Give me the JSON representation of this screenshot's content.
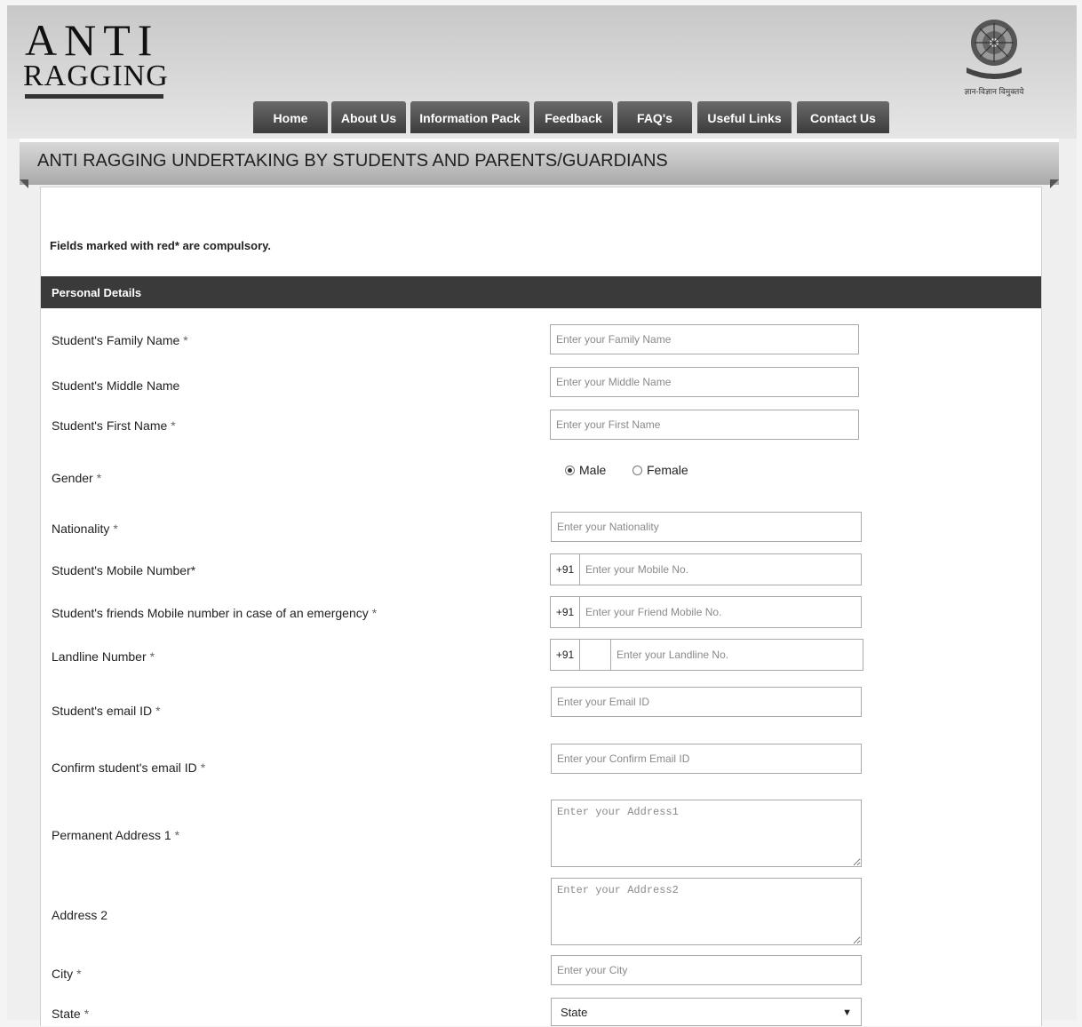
{
  "header": {
    "logo_line1": "ANTI",
    "logo_line2": "RAGGING",
    "emblem_caption": "ज्ञान-विज्ञान विमुक्तये"
  },
  "nav": {
    "items": [
      "Home",
      "About Us",
      "Information Pack",
      "Feedback",
      "FAQ's",
      "Useful Links",
      "Contact Us"
    ]
  },
  "page_title": "ANTI RAGGING UNDERTAKING BY STUDENTS AND PARENTS/GUARDIANS",
  "form": {
    "note": "Fields marked with red* are compulsory.",
    "section_title": "Personal Details",
    "family_name": {
      "label": "Student's Family Name",
      "required": "*",
      "placeholder": "Enter your Family Name"
    },
    "middle_name": {
      "label": "Student's Middle Name",
      "placeholder": "Enter your Middle Name"
    },
    "first_name": {
      "label": "Student's First Name",
      "required": "*",
      "placeholder": "Enter your First Name"
    },
    "gender": {
      "label": "Gender",
      "required": "*",
      "options": [
        "Male",
        "Female"
      ],
      "selected": "Male"
    },
    "nationality": {
      "label": "Nationality",
      "required": "*",
      "placeholder": "Enter your Nationality"
    },
    "mobile": {
      "label": "Student's Mobile Number*",
      "prefix": "+91",
      "placeholder": "Enter your Mobile No."
    },
    "friend_mobile": {
      "label": "Student's friends Mobile number in case of an emergency",
      "required": "*",
      "prefix": "+91",
      "placeholder": "Enter your Friend Mobile No."
    },
    "landline": {
      "label": "Landline Number",
      "required": "*",
      "prefix": "+91",
      "placeholder": "Enter your Landline No."
    },
    "email": {
      "label": "Student's email ID",
      "required": "*",
      "placeholder": "Enter your Email ID"
    },
    "confirm_email": {
      "label": "Confirm student's email ID",
      "required": "*",
      "placeholder": "Enter your Confirm Email ID"
    },
    "address1": {
      "label": "Permanent Address 1",
      "required": "*",
      "placeholder": "Enter your Address1"
    },
    "address2": {
      "label": "Address 2",
      "placeholder": "Enter your Address2"
    },
    "city": {
      "label": "City",
      "required": "*",
      "placeholder": "Enter your City"
    },
    "state": {
      "label": "State",
      "required": "*",
      "selected": "State"
    }
  }
}
